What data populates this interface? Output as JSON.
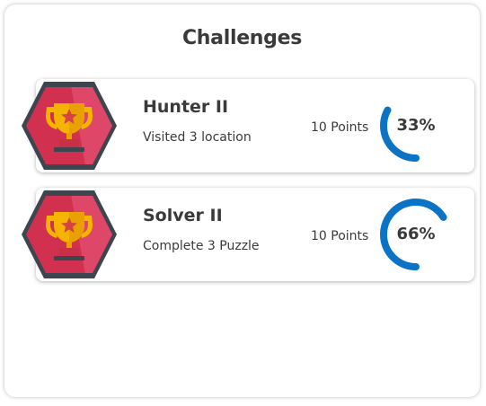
{
  "panel": {
    "title": "Challenges"
  },
  "colors": {
    "accent": "#0a73c6",
    "badge_red": "#d2304f",
    "badge_border": "#3d4550",
    "trophy_gold": "#f5b400"
  },
  "challenges": [
    {
      "title": "Hunter II",
      "description": "Visited 3 location",
      "points": "10 Points",
      "progress_label": "33%",
      "progress": 0.33,
      "icon": "trophy-icon"
    },
    {
      "title": "Solver II",
      "description": "Complete 3 Puzzle",
      "points": "10 Points",
      "progress_label": "66%",
      "progress": 0.66,
      "icon": "trophy-icon"
    }
  ]
}
